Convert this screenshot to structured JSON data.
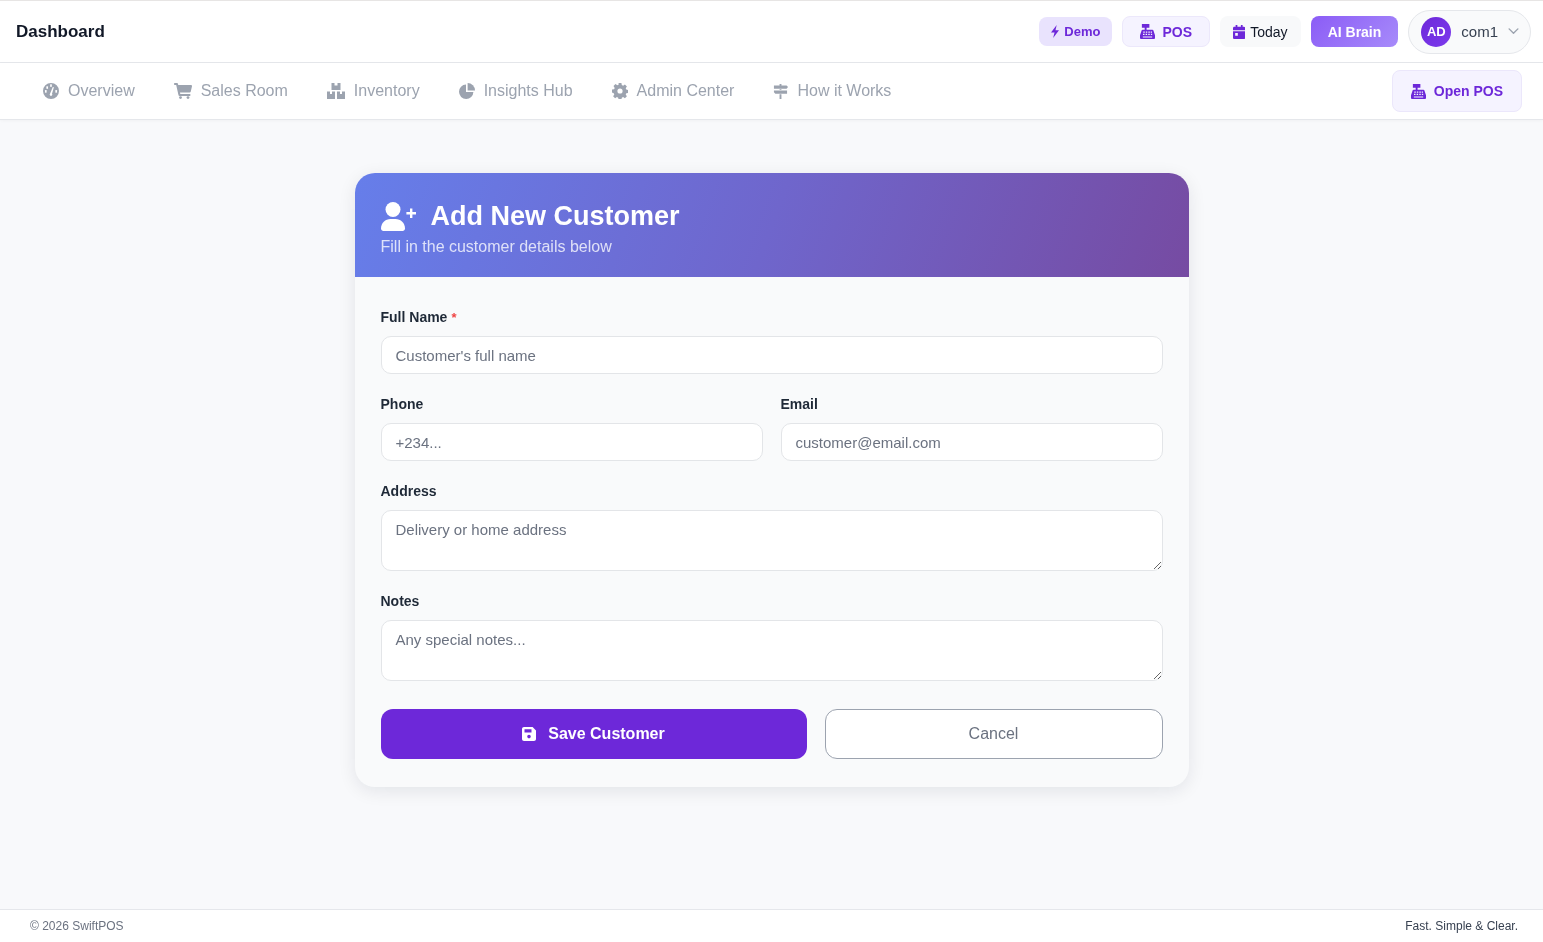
{
  "header": {
    "title": "Dashboard",
    "actions": [
      {
        "label": "Demo",
        "kind": "demo"
      },
      {
        "label": "POS",
        "kind": "pos"
      },
      {
        "label": "Today",
        "kind": "today"
      },
      {
        "label": "AI Brain",
        "kind": "ai"
      }
    ],
    "user": {
      "initials": "AD",
      "name": "com1"
    }
  },
  "nav": {
    "items": [
      {
        "label": "Overview",
        "selected": false
      },
      {
        "label": "Sales Room",
        "selected": false
      },
      {
        "label": "Inventory",
        "selected": false
      },
      {
        "label": "Insights Hub",
        "selected": false
      },
      {
        "label": "Admin Center",
        "selected": false
      },
      {
        "label": "How it Works",
        "selected": false
      }
    ],
    "action": {
      "label": "Open POS"
    }
  },
  "form": {
    "title": "Add New Customer",
    "subtitle": "Fill in the customer details below",
    "rows": [
      {
        "fields": [
          {
            "label": "Full Name",
            "required_mark": "*",
            "kind": "input",
            "placeholder": "Customer's full name"
          }
        ]
      },
      {
        "fields": [
          {
            "label": "Phone",
            "kind": "input",
            "placeholder": "+234..."
          },
          {
            "label": "Email",
            "kind": "input",
            "placeholder": "customer@email.com"
          }
        ]
      },
      {
        "fields": [
          {
            "label": "Address",
            "kind": "textarea",
            "placeholder": "Delivery or home address"
          }
        ]
      },
      {
        "fields": [
          {
            "label": "Notes",
            "kind": "textarea",
            "placeholder": "Any special notes..."
          }
        ]
      }
    ],
    "buttons": [
      {
        "label": "Save Customer",
        "kind": "primary"
      },
      {
        "label": "Cancel",
        "kind": "secondary"
      }
    ]
  },
  "footer": {
    "copyright": "© 2026 SwiftPOS",
    "tagline": "Fast. Simple & Clear."
  }
}
